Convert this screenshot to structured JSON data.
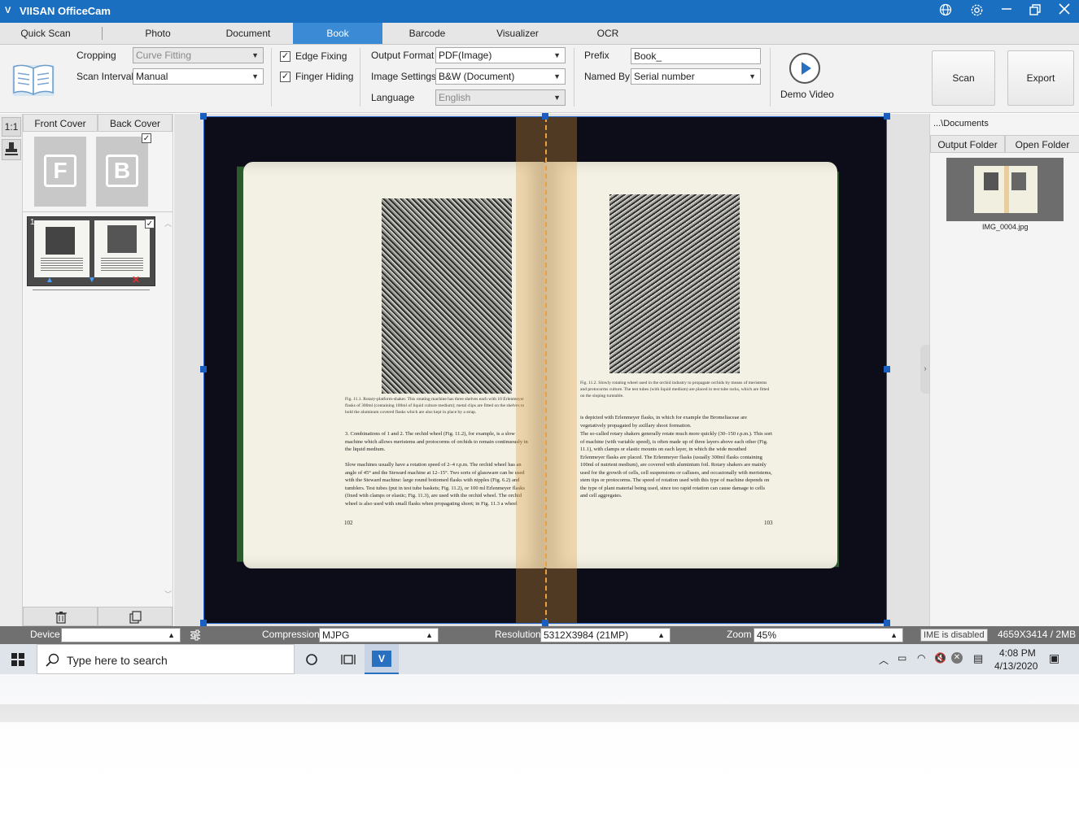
{
  "titlebar": {
    "logo": "V",
    "title": "VIISAN OfficeCam",
    "icons": [
      "globe-icon",
      "gear-icon",
      "minimize-icon",
      "restore-icon",
      "close-icon"
    ]
  },
  "tabs": [
    {
      "label": "Quick Scan"
    },
    {
      "label": "Photo"
    },
    {
      "label": "Document"
    },
    {
      "label": "Book"
    },
    {
      "label": "Barcode"
    },
    {
      "label": "Visualizer"
    },
    {
      "label": "OCR"
    }
  ],
  "ribbon": {
    "cropping_label": "Cropping",
    "cropping_value": "Curve Fitting",
    "scan_interval_label": "Scan Interval",
    "scan_interval_value": "Manual",
    "edge_fixing_label": "Edge Fixing",
    "edge_fixing_checked": true,
    "finger_hiding_label": "Finger Hiding",
    "finger_hiding_checked": true,
    "output_format_label": "Output Format",
    "output_format_value": "PDF(Image)",
    "image_settings_label": "Image Settings",
    "image_settings_value": "B&W (Document)",
    "language_label": "Language",
    "language_value": "English",
    "prefix_label": "Prefix",
    "prefix_value": "Book_",
    "named_by_label": "Named By",
    "named_by_value": "Serial number",
    "demo_video_label": "Demo Video",
    "scan_label": "Scan",
    "export_label": "Export"
  },
  "left": {
    "ratio_label": "1:1",
    "front_cover_label": "Front Cover",
    "back_cover_label": "Back Cover",
    "front_letter": "F",
    "back_letter": "B",
    "page_number": "1"
  },
  "right": {
    "path_label": "...\\Documents",
    "output_folder_label": "Output Folder",
    "open_folder_label": "Open Folder",
    "thumb_name": "IMG_0004.jpg"
  },
  "book": {
    "left_caption": "Fig. 11.1. Rotary-platform-shaker. This rotating machine has three shelves each with 10 Erlenmeyer flasks of 300ml (containing 100ml of liquid culture medium); metal clips are fitted on the shelves to hold the aluminum covered flasks which are also kept in place by a strap.",
    "left_para1": "3. Combinations of 1 and 2. The orchid wheel (Fig. 11.2), for example, is a slow machine which allows meristems and protocorms of orchids to remain continuously in the liquid medium.",
    "left_para2": "Slow machines usually have a rotation speed of 2–4 r.p.m. The orchid wheel has an angle of 45° and the Steward machine at 12–15°. Two sorts of glassware can be used with the Steward machine: large round bottomed flasks with nipples (Fig. 6.2) and tumblers. Test tubes (put in test tube baskets; Fig. 11.2), or 100 ml Erlenmeyer flasks (fixed with clamps or elastic; Fig. 11.3), are used with the orchid wheel. The orchid wheel is also used with small flasks when propagating shoot; in Fig. 11.3 a wheel",
    "left_page": "102",
    "right_caption": "Fig. 11.2. Slowly rotating wheel used in the orchid industry to propagate orchids by means of meristems and protocorms culture. The test tubes (with liquid medium) are placed in test tube racks, which are fitted on the sloping turntable.",
    "right_para1": "is depicted with Erlenmeyer flasks, in which for example the Bromeliaceae are vegetatively propagated by axillary shoot formation.",
    "right_para2": "The so-called rotary shakers generally rotate much more quickly (30–150 r.p.m.). This sort of machine (with variable speed), is often made up of three layers above each other (Fig. 11.1), with clamps or elastic mounts on each layer, in which the wide mouthed Erlenmeyer flasks are placed. The Erlenmeyer flasks (usually 300ml flasks containing 100ml of nutrient medium), are covered with aluminium foil. Rotary shakers are mainly used for the growth of cells, cell suspensions or calluses, and occasionally with meristems, stem tips or protocorms. The speed of rotation used with this type of machine depends on the type of plant material being used, since too rapid rotation can cause damage to cells and cell aggregates.",
    "right_page": "103"
  },
  "statusbar": {
    "device_label": "Device",
    "device_value": "",
    "compression_label": "Compression",
    "compression_value": "MJPG",
    "resolution_label": "Resolution",
    "resolution_value": "5312X3984 (21MP)",
    "zoom_label": "Zoom",
    "zoom_value": "45%",
    "ime_tooltip": "IME is disabled",
    "image_info": "4659X3414 / 2MB"
  },
  "taskbar": {
    "search_placeholder": "Type here to search",
    "time": "4:08 PM",
    "date": "4/13/2020"
  },
  "colors": {
    "titlebar": "#1a6fc0",
    "active_tab": "#3a8ad6",
    "scan_bg": "#0d0d1a",
    "book_cover": "#2c5a2c",
    "page": "#f3f1e3",
    "center_highlight": "#e09a3a"
  }
}
